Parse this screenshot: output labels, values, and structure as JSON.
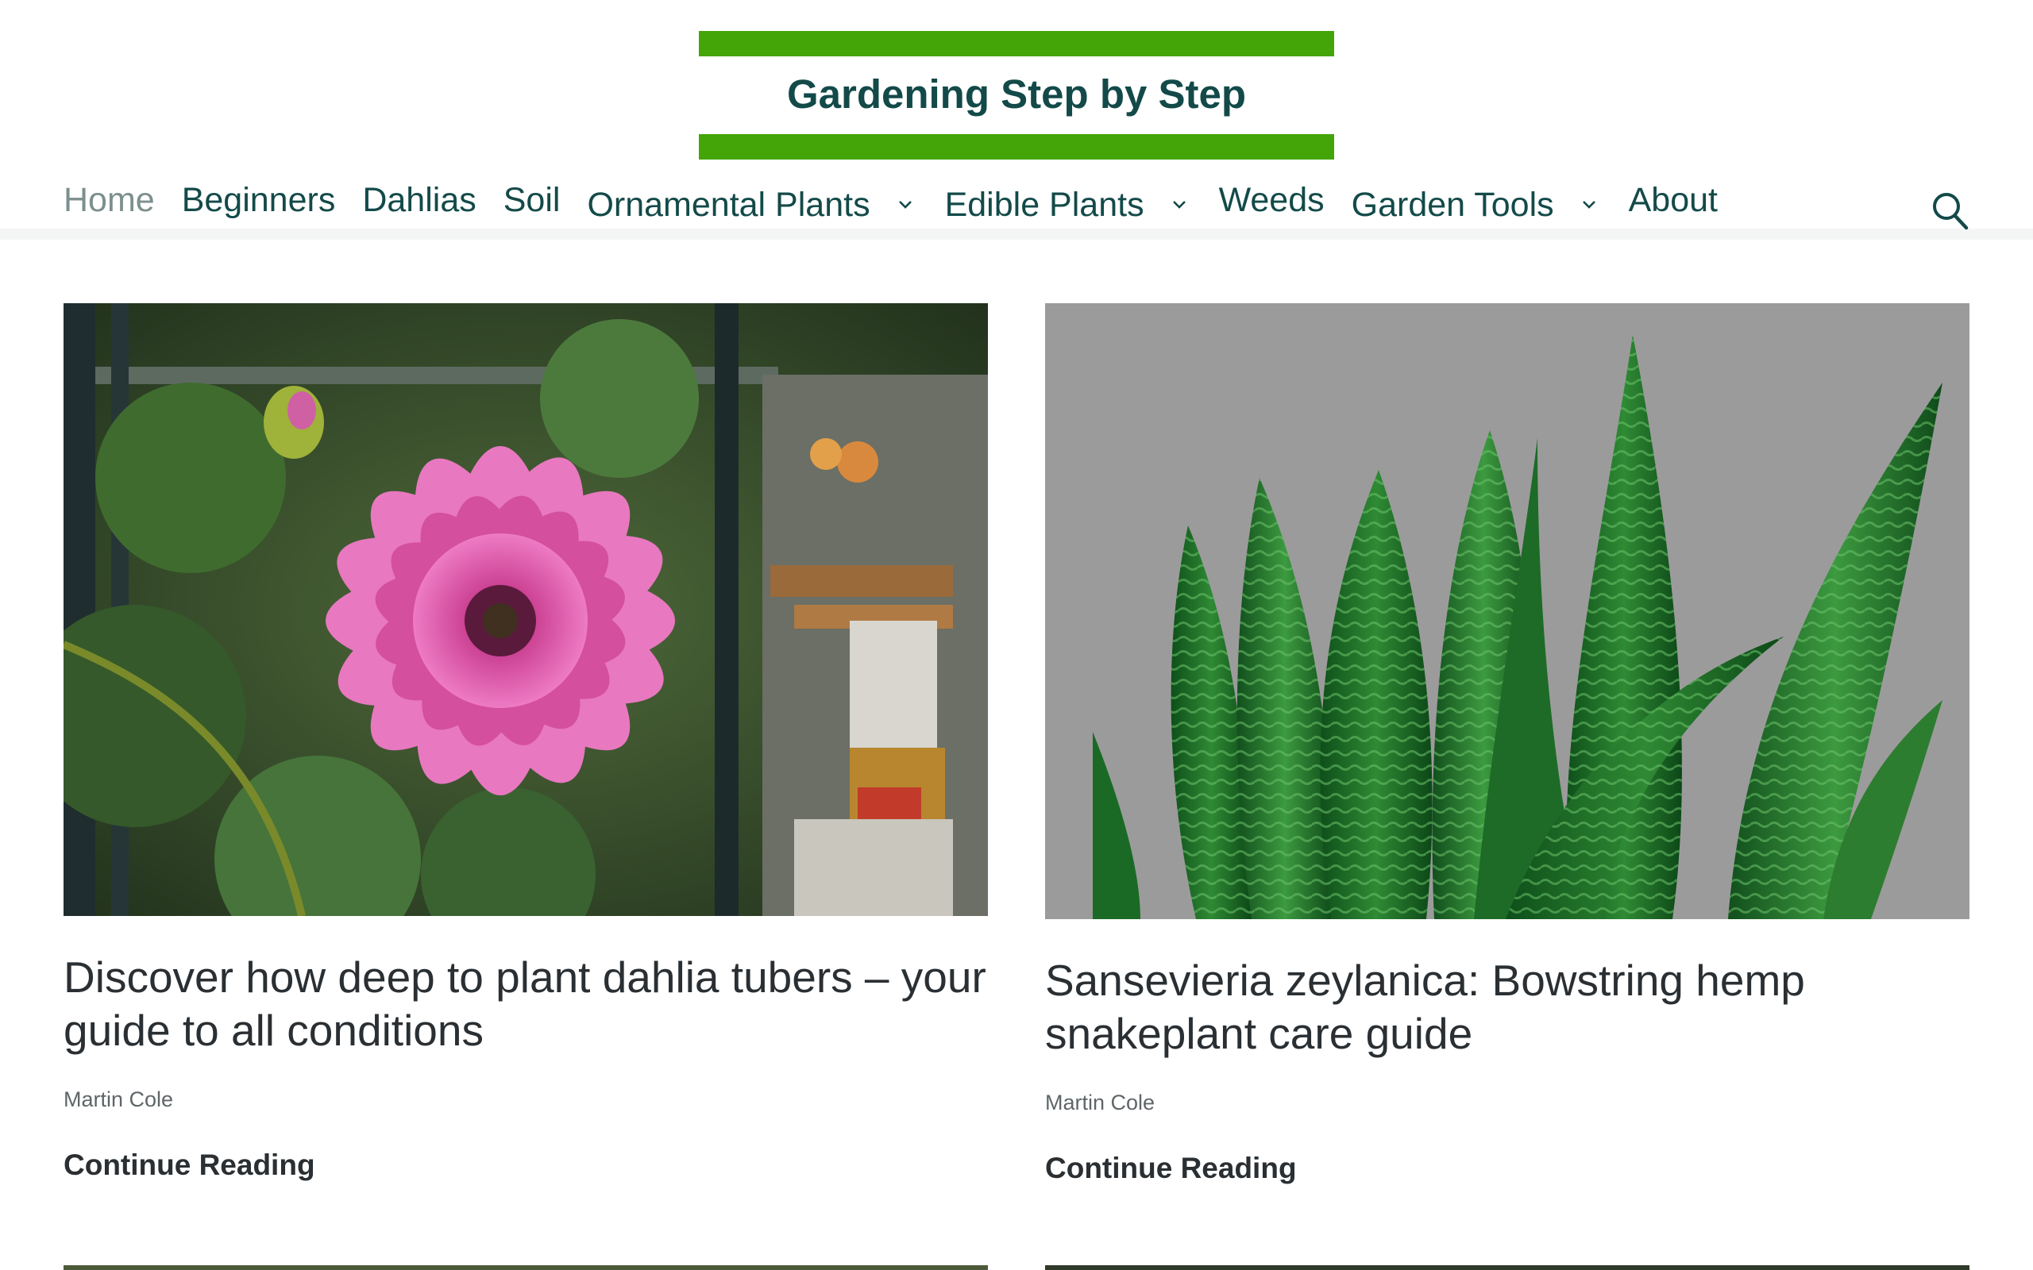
{
  "site": {
    "title": "Gardening Step by Step",
    "brand_green": "#44a508",
    "brand_dark": "#134a49"
  },
  "nav": {
    "items": [
      {
        "label": "Home",
        "current": true,
        "has_submenu": false
      },
      {
        "label": "Beginners",
        "current": false,
        "has_submenu": false
      },
      {
        "label": "Dahlias",
        "current": false,
        "has_submenu": false
      },
      {
        "label": "Soil",
        "current": false,
        "has_submenu": false
      },
      {
        "label": "Ornamental Plants",
        "current": false,
        "has_submenu": true
      },
      {
        "label": "Edible Plants",
        "current": false,
        "has_submenu": true
      },
      {
        "label": "Weeds",
        "current": false,
        "has_submenu": false
      },
      {
        "label": "Garden Tools",
        "current": false,
        "has_submenu": true
      },
      {
        "label": "About",
        "current": false,
        "has_submenu": false
      }
    ],
    "submenu_icon": "chevron-down-icon",
    "search_icon": "search-icon"
  },
  "posts": [
    {
      "title": "Discover how deep to plant dahlia tubers – your guide to all conditions",
      "author": "Martin Cole",
      "read_more": "Continue Reading",
      "image": "pink-dahlia-flower-in-greenhouse"
    },
    {
      "title": "Sansevieria zeylanica: Bowstring hemp snakeplant care guide",
      "author": "Martin Cole",
      "read_more": "Continue Reading",
      "image": "snake-plant-leaves-on-grey-background"
    }
  ]
}
